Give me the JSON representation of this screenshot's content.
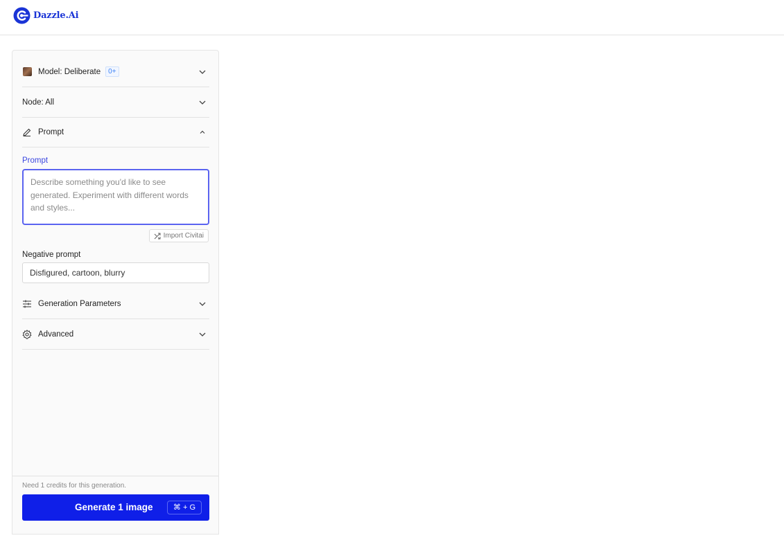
{
  "app": {
    "brand": "Dazzle.Ai",
    "brand_color": "#1a34d6"
  },
  "panel": {
    "model": {
      "label": "Model: Deliberate",
      "badge": "0+",
      "icon": "model-thumbnail",
      "expanded": false
    },
    "node": {
      "label": "Node: All",
      "expanded": false
    },
    "prompt_section": {
      "label": "Prompt",
      "icon": "pencil-icon",
      "expanded": true
    },
    "prompt": {
      "label": "Prompt",
      "value": "",
      "placeholder": "Describe something you'd like to see generated. Experiment with different words and styles..."
    },
    "import_button": {
      "label": "Import Civitai",
      "icon": "shuffle-icon"
    },
    "negative_prompt": {
      "label": "Negative prompt",
      "value": "Disfigured, cartoon, blurry"
    },
    "generation_parameters": {
      "label": "Generation Parameters",
      "icon": "sliders-icon",
      "expanded": false
    },
    "advanced": {
      "label": "Advanced",
      "icon": "gear-icon",
      "expanded": false
    }
  },
  "footer": {
    "credits_text": "Need 1 credits for this generation.",
    "generate_label": "Generate 1 image",
    "shortcut": "⌘ + G",
    "accent_color": "#0f1fe8"
  }
}
